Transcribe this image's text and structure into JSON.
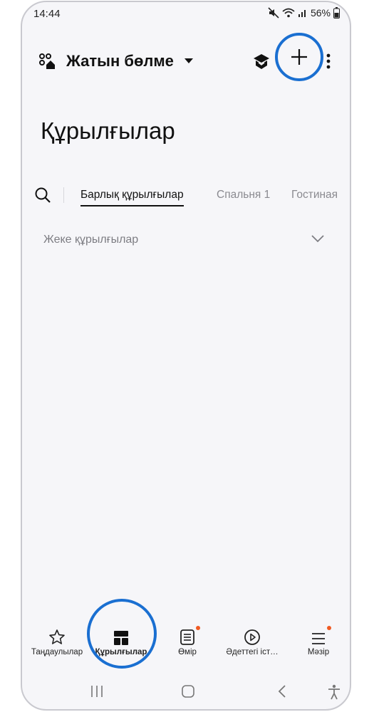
{
  "status": {
    "time": "14:44",
    "battery": "56%"
  },
  "header": {
    "home_name": "Жатын бөлме",
    "icons": {
      "home": "home-qr-icon",
      "hub": "hub-icon",
      "add": "plus-icon",
      "more": "more-vertical-icon"
    }
  },
  "page": {
    "title": "Құрылғылар"
  },
  "tabs": [
    {
      "label": "Барлық құрылғылар",
      "active": true
    },
    {
      "label": "Спальня 1",
      "active": false
    },
    {
      "label": "Гостиная",
      "active": false
    }
  ],
  "section": {
    "label": "Жеке құрылғылар"
  },
  "bottom_nav": [
    {
      "label": "Таңдаулылар",
      "icon": "star-icon"
    },
    {
      "label": "Құрылғылар",
      "icon": "devices-icon",
      "active": true
    },
    {
      "label": "Өмір",
      "icon": "life-icon",
      "badge": true
    },
    {
      "label": "Әдеттегі іст…",
      "icon": "play-circle-icon"
    },
    {
      "label": "Мәзір",
      "icon": "menu-icon",
      "badge": true
    }
  ],
  "colors": {
    "accent_ring": "#1a6fd1",
    "badge": "#f05a22",
    "background": "#f6f6f9"
  }
}
